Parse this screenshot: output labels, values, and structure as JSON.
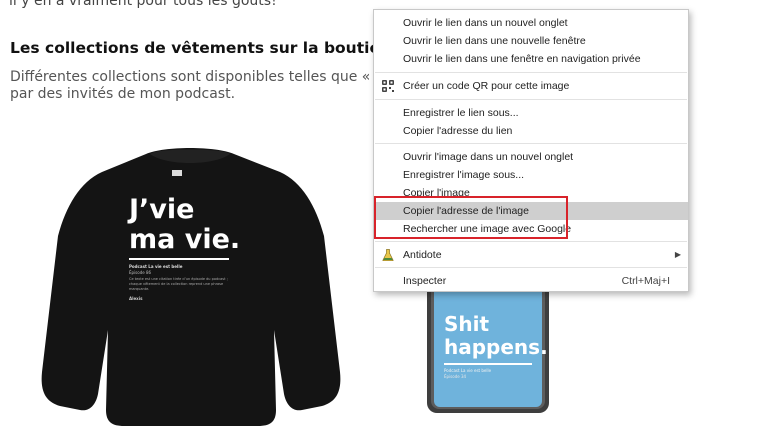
{
  "page": {
    "top_text": "il y en a vraiment pour tous les goûts!",
    "heading": "Les collections de vêtements sur la boutic.ca",
    "para_line1": "Différentes collections sont disponibles telles que « Citations",
    "para_line2": "par des invités de mon podcast."
  },
  "sweater": {
    "line1": "J’vie",
    "line2": "ma vie.",
    "caption_title": "Podcast La vie est belle",
    "caption_sub": "Épisode 86",
    "caption_body": "Ce texte est une citation tirée d’un épisode du podcast ; chaque vêtement de la collection reprend une phrase marquante.",
    "signature": "Alexis"
  },
  "phone": {
    "line1": "Shit",
    "line2": "happens.",
    "caption_title": "Podcast La vie est belle",
    "caption_sub": "Épisode 34"
  },
  "context_menu": {
    "items": [
      "Ouvrir le lien dans un nouvel onglet",
      "Ouvrir le lien dans une nouvelle fenêtre",
      "Ouvrir le lien dans une fenêtre en navigation privée",
      "Créer un code QR pour cette image",
      "Enregistrer le lien sous...",
      "Copier l'adresse du lien",
      "Ouvrir l'image dans un nouvel onglet",
      "Enregistrer l'image sous...",
      "Copier l'image",
      "Copier l'adresse de l'image",
      "Rechercher une image avec Google",
      "Antidote",
      "Inspecter"
    ],
    "inspect_shortcut": "Ctrl+Maj+I",
    "highlighted_item": "Copier l'adresse de l'image"
  },
  "colors": {
    "highlight": "#cfcfcf",
    "annotation_box": "#d8232a",
    "phone_screen": "#6fb3dc",
    "sweater": "#141414"
  }
}
